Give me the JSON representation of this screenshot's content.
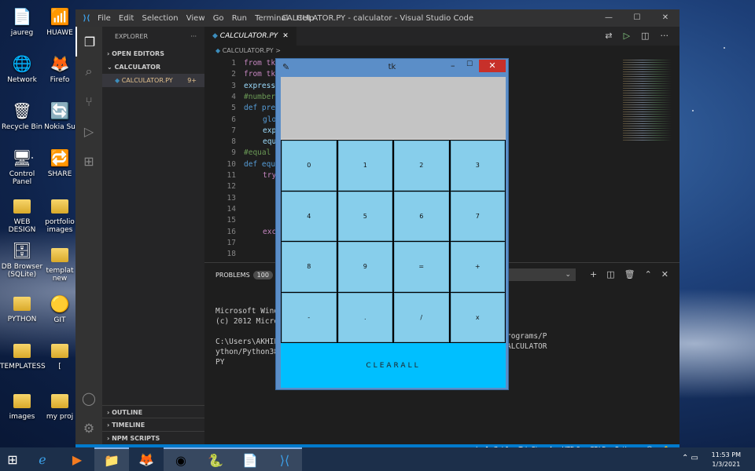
{
  "desktop": {
    "icons_left": [
      "jaureg",
      "Network",
      "Recycle Bin",
      "Control Panel",
      "WEB DESIGN",
      "DB Browser (SQLite)",
      "PYTHON",
      "TEMPLATESS",
      "images"
    ],
    "icons_right": [
      "HUAWE",
      "Firefo",
      "Nokia Su",
      "SHARE",
      "portfolio images",
      "templat new",
      "GIT",
      "[",
      "my proj"
    ]
  },
  "vscode": {
    "title": "CALCULATOR.PY - calculator - Visual Studio Code",
    "menu": [
      "File",
      "Edit",
      "Selection",
      "View",
      "Go",
      "Run",
      "Terminal",
      "Help"
    ],
    "explorer_label": "EXPLORER",
    "open_editors": "OPEN EDITORS",
    "folder": "CALCULATOR",
    "file": "CALCULATOR.PY",
    "file_badge": "9+",
    "outline": "OUTLINE",
    "timeline": "TIMELINE",
    "npm_scripts": "NPM SCRIPTS",
    "tab": "CALCULATOR.PY",
    "breadcrumb": "CALCULATOR.PY >",
    "code_lines": [
      "from tk",
      "from tk",
      "express",
      "#number",
      "def pre",
      "glo",
      "exp",
      "equ",
      "#equal",
      "def equ",
      "try",
      "",
      "",
      "",
      "",
      "exc",
      "",
      ""
    ],
    "line_numbers": [
      "1",
      "2",
      "3",
      "4",
      "5",
      "6",
      "7",
      "8",
      "9",
      "10",
      "11",
      "12",
      "13",
      "14",
      "15",
      "16",
      "17",
      "18"
    ],
    "panel_tab": "PROBLEMS",
    "problems_count": "100",
    "shell_selector": "n",
    "terminal": [
      "Microsoft Windo",
      "(c) 2012 Micros",
      "",
      "C:\\Users\\AKHIL'",
      "ython/Python38",
      "PY"
    ],
    "terminal_right": [
      "rograms/P",
      "ALCULATOR"
    ],
    "status": [
      "Ln 1, Col 1",
      "Tab Size: 4",
      "UTF-8",
      "CRLF",
      "Python"
    ]
  },
  "tk": {
    "title": "tk",
    "close": "✕",
    "keys": [
      [
        "0",
        "1",
        "2",
        "3"
      ],
      [
        "4",
        "5",
        "6",
        "7"
      ],
      [
        "8",
        "9",
        "=",
        "+"
      ],
      [
        "-",
        ".",
        "/",
        "x"
      ]
    ],
    "clear_label": "CLEARALL"
  },
  "taskbar": {
    "time": "11:53 PM",
    "date": "1/3/2021"
  }
}
